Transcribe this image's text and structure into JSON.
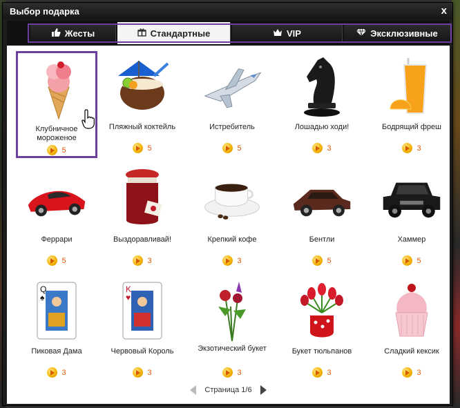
{
  "window": {
    "title": "Выбор подарка",
    "close_label": "x"
  },
  "tabs": [
    {
      "label": "Жесты",
      "icon": "thumbs-up-icon"
    },
    {
      "label": "Стандартные",
      "icon": "gift-icon"
    },
    {
      "label": "VIP",
      "icon": "crown-icon"
    },
    {
      "label": "Эксклюзивные",
      "icon": "diamond-icon"
    }
  ],
  "active_tab": "Стандартные",
  "gifts": [
    {
      "name": "Клубничное мороженое",
      "price": "5",
      "icon": "ice-cream-icon",
      "selected": true
    },
    {
      "name": "Пляжный коктейль",
      "price": "5",
      "icon": "coconut-cocktail-icon"
    },
    {
      "name": "Истребитель",
      "price": "5",
      "icon": "fighter-jet-icon"
    },
    {
      "name": "Лошадью ходи!",
      "price": "3",
      "icon": "chess-knight-icon"
    },
    {
      "name": "Бодрящий фреш",
      "price": "3",
      "icon": "orange-juice-icon"
    },
    {
      "name": "Феррари",
      "price": "5",
      "icon": "red-sports-car-icon"
    },
    {
      "name": "Выздоравливай!",
      "price": "3",
      "icon": "jam-jar-icon"
    },
    {
      "name": "Крепкий кофе",
      "price": "3",
      "icon": "coffee-cup-icon"
    },
    {
      "name": "Бентли",
      "price": "5",
      "icon": "luxury-car-icon"
    },
    {
      "name": "Хаммер",
      "price": "5",
      "icon": "suv-icon"
    },
    {
      "name": "Пиковая Дама",
      "price": "3",
      "icon": "queen-of-spades-card-icon"
    },
    {
      "name": "Червовый Король",
      "price": "3",
      "icon": "king-of-hearts-card-icon"
    },
    {
      "name": "Экзотический букет",
      "price": "3",
      "icon": "exotic-bouquet-icon"
    },
    {
      "name": "Букет тюльпанов",
      "price": "3",
      "icon": "tulip-bouquet-icon"
    },
    {
      "name": "Сладкий кексик",
      "price": "3",
      "icon": "cupcake-icon"
    }
  ],
  "pager": {
    "label": "Страница 1/6"
  },
  "colors": {
    "selection": "#6b3fa0",
    "price": "#e35a00",
    "coin": "#f3b000"
  }
}
